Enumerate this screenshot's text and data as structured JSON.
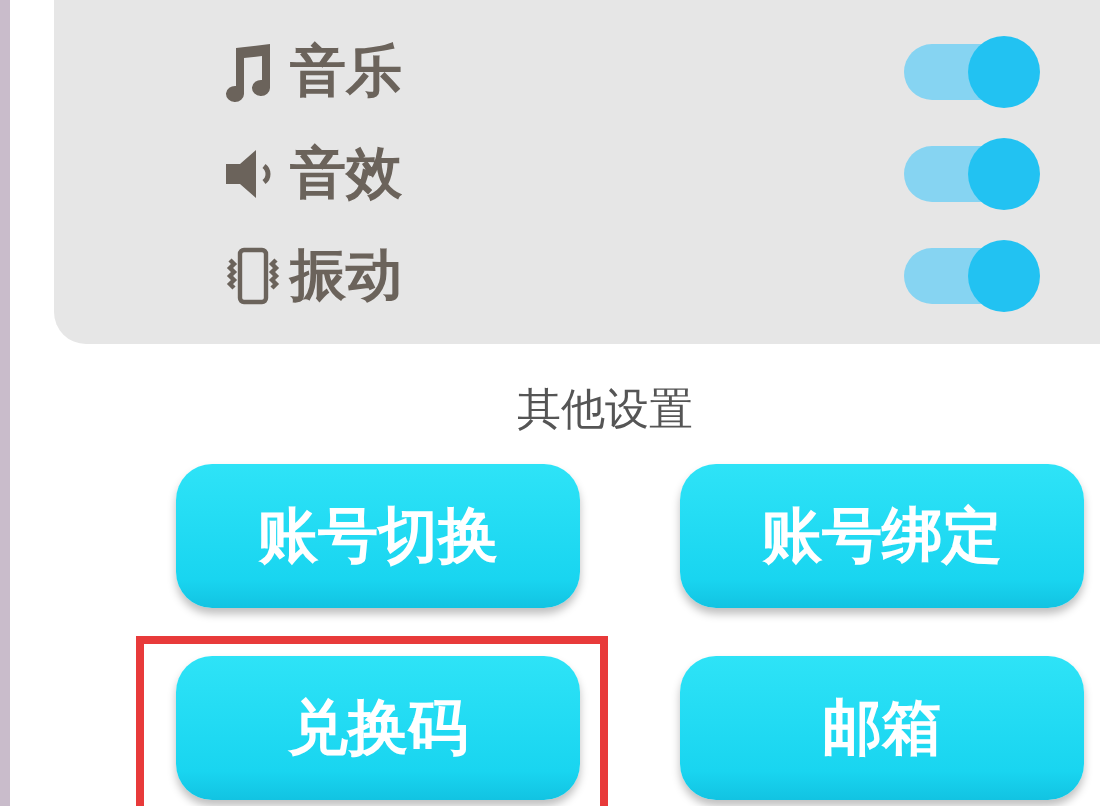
{
  "settings": [
    {
      "kind": "music",
      "label": "音乐",
      "on": true
    },
    {
      "kind": "sound",
      "label": "音效",
      "on": true
    },
    {
      "kind": "vibrate",
      "label": "振动",
      "on": true
    }
  ],
  "other_heading": "其他设置",
  "buttons": [
    {
      "label": "账号切换",
      "highlighted": false
    },
    {
      "label": "账号绑定",
      "highlighted": false
    },
    {
      "label": "兑换码",
      "highlighted": true
    },
    {
      "label": "邮箱",
      "highlighted": false
    }
  ]
}
